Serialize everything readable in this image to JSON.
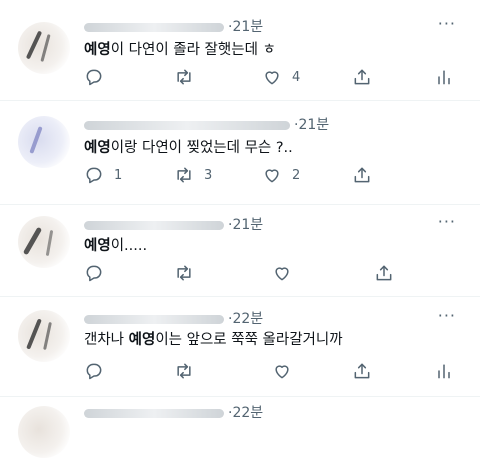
{
  "tweets": [
    {
      "time": "·21분",
      "highlight": "예영",
      "text": "이 다연이 졸라 잘햇는데 ㅎ",
      "replies": "",
      "retweets": "",
      "likes": "4"
    },
    {
      "time": "·21분",
      "highlight": "예영",
      "text": "이랑 다연이 찢었는데 무슨 ?..",
      "replies": "1",
      "retweets": "3",
      "likes": "2"
    },
    {
      "time": "·21분",
      "highlight": "예영",
      "text": "이.....",
      "replies": "",
      "retweets": "",
      "likes": ""
    },
    {
      "time": "·22분",
      "prefix": "갠차나 ",
      "highlight": "예영",
      "text": "이는 앞으로 쭉쭉 올라갈거니까",
      "replies": "",
      "retweets": "",
      "likes": ""
    },
    {
      "time": "·22분"
    }
  ],
  "icons": {
    "reply": "reply-icon",
    "retweet": "retweet-icon",
    "like": "heart-icon",
    "share": "share-icon",
    "analytics": "analytics-icon",
    "more": "more-icon"
  }
}
